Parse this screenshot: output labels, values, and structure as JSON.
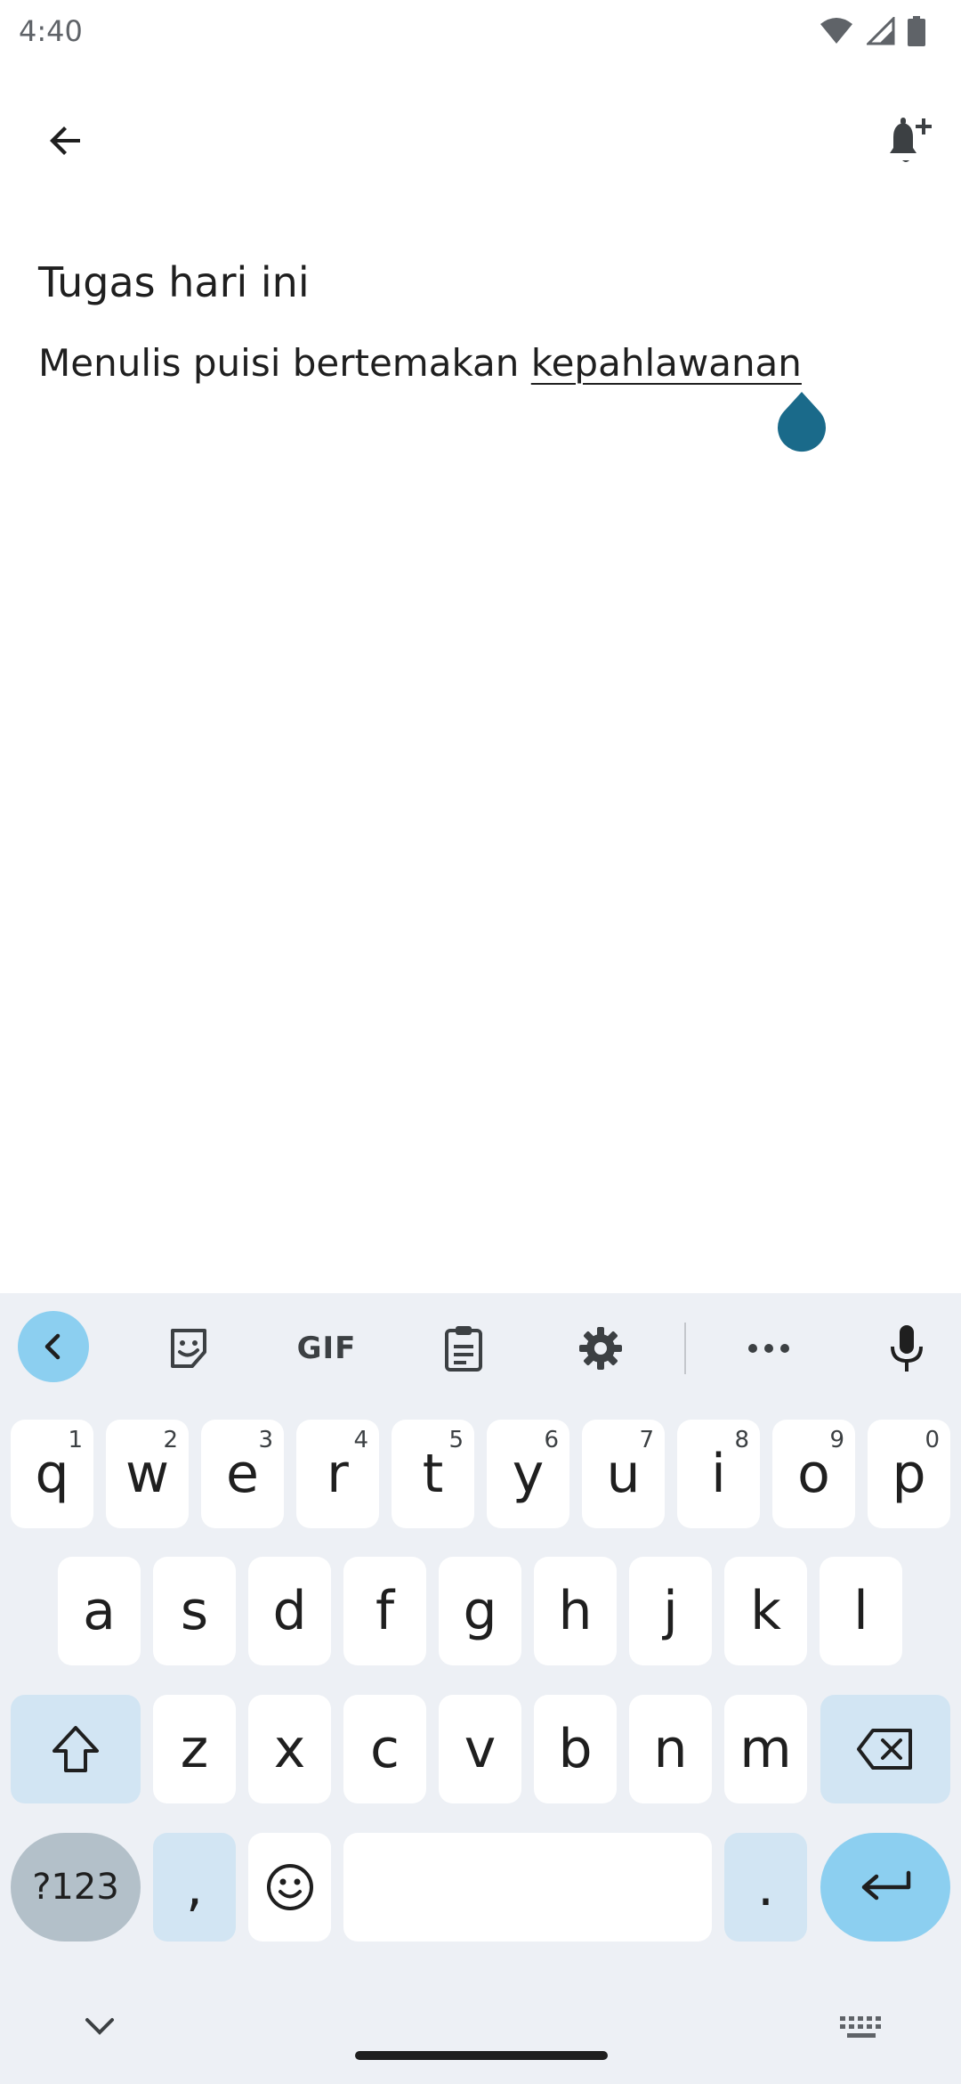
{
  "status_bar": {
    "time": "4:40",
    "icons": [
      "wifi-icon",
      "signal-icon",
      "battery-icon"
    ]
  },
  "app_bar": {
    "back_icon": "arrow-back-icon",
    "reminder_icon": "add-alert-icon"
  },
  "note": {
    "title": "Tugas hari ini",
    "body_prefix": "Menulis puisi bertemakan ",
    "body_underlined_word": "kepahlawanan"
  },
  "keyboard": {
    "toolbar": {
      "collapse_icon": "chevron-left-icon",
      "sticker_icon": "sticker-icon",
      "gif_label": "GIF",
      "clipboard_icon": "clipboard-icon",
      "settings_icon": "gear-icon",
      "more_icon": "more-horizontal-icon",
      "mic_icon": "mic-icon"
    },
    "row1": [
      {
        "label": "q",
        "sup": "1"
      },
      {
        "label": "w",
        "sup": "2"
      },
      {
        "label": "e",
        "sup": "3"
      },
      {
        "label": "r",
        "sup": "4"
      },
      {
        "label": "t",
        "sup": "5"
      },
      {
        "label": "y",
        "sup": "6"
      },
      {
        "label": "u",
        "sup": "7"
      },
      {
        "label": "i",
        "sup": "8"
      },
      {
        "label": "o",
        "sup": "9"
      },
      {
        "label": "p",
        "sup": "0"
      }
    ],
    "row2": [
      "a",
      "s",
      "d",
      "f",
      "g",
      "h",
      "j",
      "k",
      "l"
    ],
    "row3": [
      "z",
      "x",
      "c",
      "v",
      "b",
      "n",
      "m"
    ],
    "row4": {
      "symbols_label": "?123",
      "comma_label": ",",
      "period_label": "."
    },
    "colors": {
      "accent": "#8ccff0",
      "function_key": "#d2e5f3",
      "symbols_key": "#b3c0c9",
      "background": "#edf0f5"
    }
  },
  "colors": {
    "cursor_handle": "#1a6a8a"
  }
}
